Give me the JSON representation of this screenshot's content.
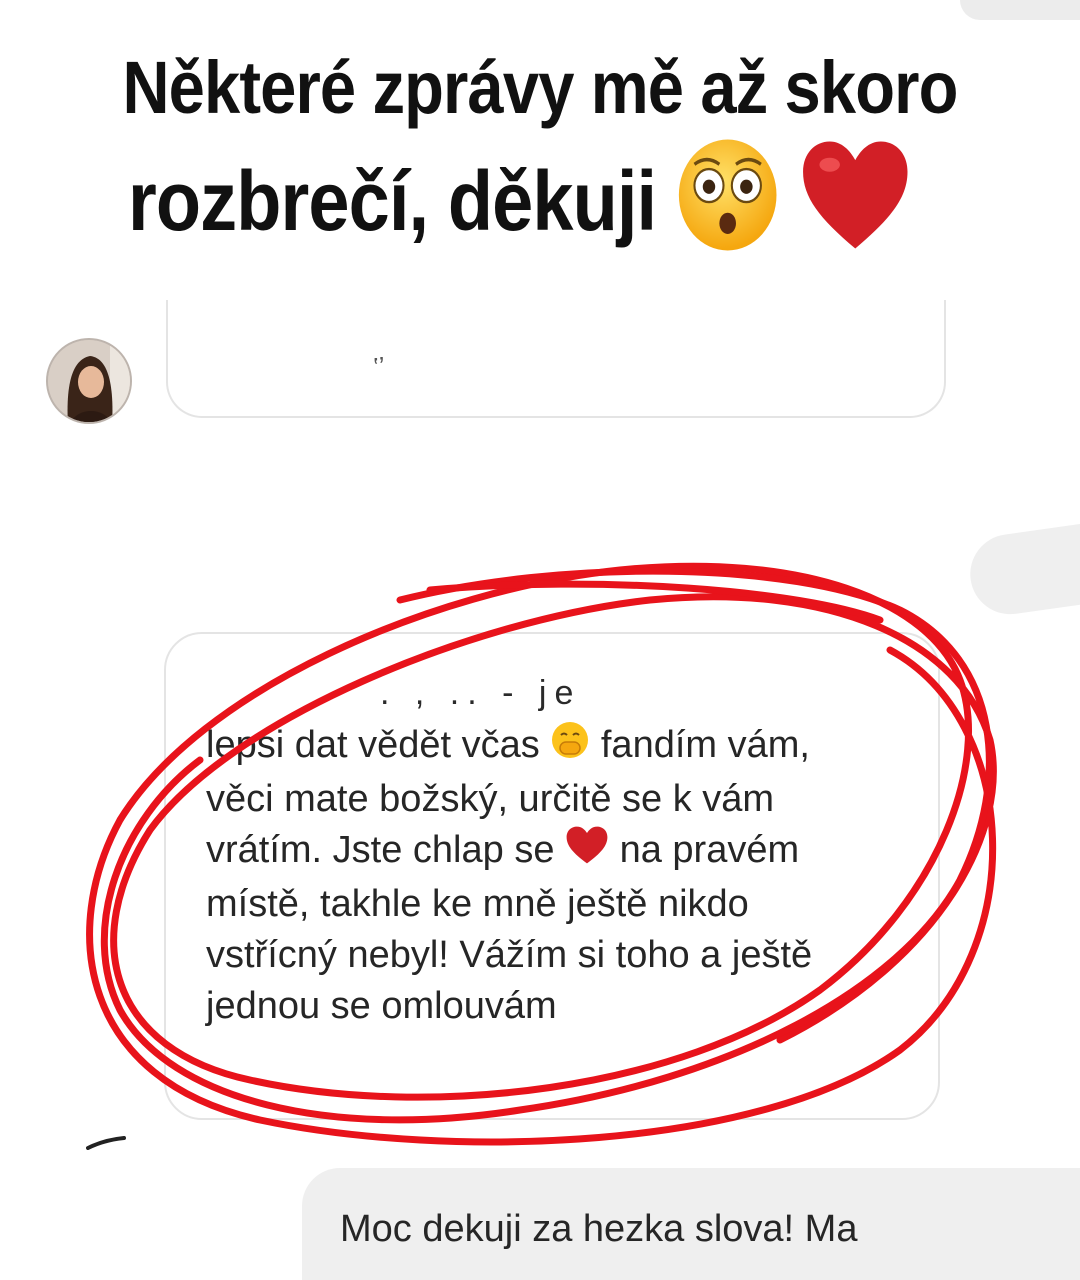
{
  "headline": {
    "line1": "Některé zprávy mě až skoro",
    "line2": "rozbrečí, děkuji"
  },
  "icons": {
    "headline_emoji_1": "flushed-face-icon",
    "headline_emoji_2": "red-heart-icon",
    "inline_emoji_1": "face-with-hand-over-mouth-icon",
    "inline_emoji_2": "red-heart-icon"
  },
  "colors": {
    "scribble": "#e8131b",
    "heart": "#d21f26",
    "emoji_yellow": "#fcc21b"
  },
  "received_message": {
    "lines": [
      "lepsi dat vědět včas",
      "fandím vám,",
      "věci mate božský, určitě se k vám",
      "vrátím. Jste chlap se",
      "na pravém",
      "místě, takhle ke mně ještě nikdo",
      "vstřícný nebyl! Vážím si toho a ještě",
      "jednou se omlouvám"
    ]
  },
  "sent_message": {
    "text": "Moc dekuji za hezka slova! Ma"
  }
}
